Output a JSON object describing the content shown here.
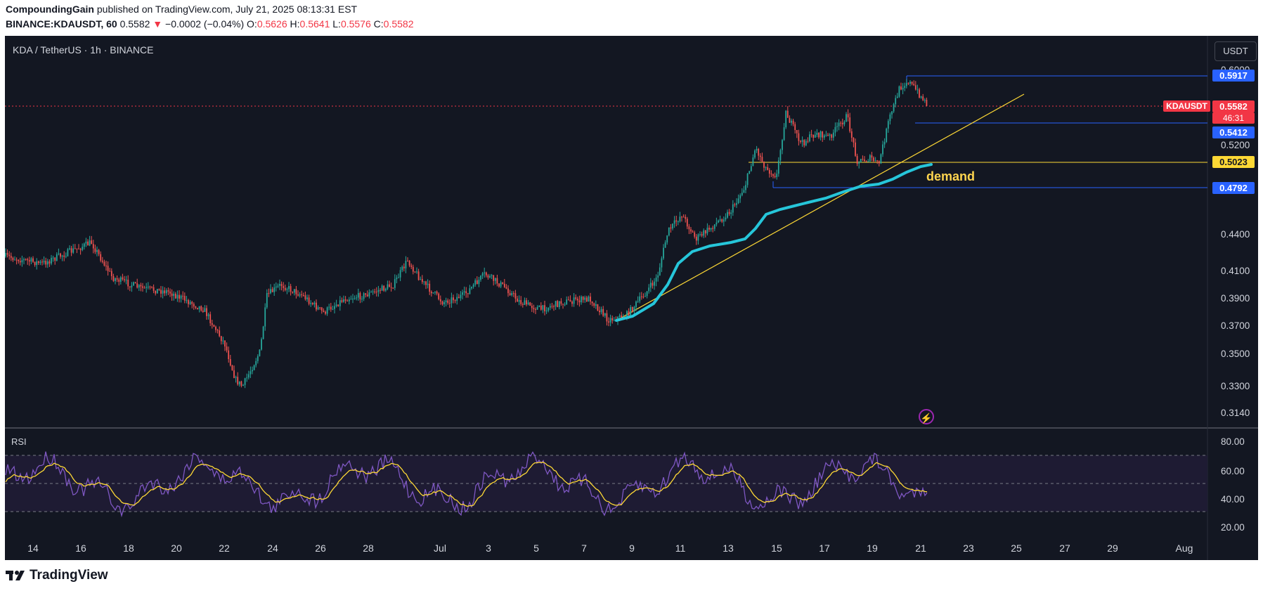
{
  "header": {
    "author": "CompoundingGain",
    "published_text": "published on TradingView.com, July 21, 2025 08:13:31 EST",
    "symbol_line": "BINANCE:KDAUSDT, 60",
    "last": "0.5582",
    "change_arrow": "▼",
    "change": "−0.0002 (−0.04%)",
    "o_label": "O:",
    "o_val": "0.5626",
    "h_label": "H:",
    "h_val": "0.5641",
    "l_label": "L:",
    "l_val": "0.5576",
    "c_label": "C:",
    "c_val": "0.5582"
  },
  "chart": {
    "title": "KDA / TetherUS · 1h · BINANCE",
    "currency_button": "USDT",
    "price_axis_labels": [
      "0.6000",
      "0.5200",
      "0.4400",
      "0.4100",
      "0.3900",
      "0.3700",
      "0.3500",
      "0.3300",
      "0.3140"
    ],
    "tags": {
      "level_5917": "0.5917",
      "symbol_tag": "KDAUSDT",
      "last_price": "0.5582",
      "countdown": "46:31",
      "level_5412": "0.5412",
      "level_5023": "0.5023",
      "level_4792": "0.4792"
    },
    "demand_label": "demand",
    "bolt_icon": "⚡"
  },
  "rsi": {
    "title": "RSI",
    "axis_labels": [
      "80.00",
      "60.00",
      "40.00",
      "20.00"
    ]
  },
  "time_axis": [
    "14",
    "16",
    "18",
    "20",
    "22",
    "24",
    "26",
    "28",
    "Jul",
    "3",
    "5",
    "7",
    "9",
    "11",
    "13",
    "15",
    "17",
    "19",
    "21",
    "23",
    "25",
    "27",
    "29",
    "Aug"
  ],
  "footer": {
    "brand": "TradingView"
  },
  "colors": {
    "background": "#131722",
    "up": "#26a69a",
    "down": "#ef5350",
    "rsi_line": "#7e57c2",
    "rsi_ma": "#fdd835",
    "ema": "#26c6da",
    "trendline": "#fdd835",
    "level_blue": "#2962ff",
    "level_yellow": "#fdd835"
  },
  "chart_data": {
    "type": "candlestick",
    "symbol": "KDA / TetherUS",
    "interval": "1h",
    "x": [
      "14",
      "16",
      "18",
      "20",
      "22",
      "24",
      "26",
      "28",
      "Jul",
      "3",
      "5",
      "7",
      "9",
      "11",
      "13",
      "15",
      "17",
      "19",
      "21"
    ],
    "close_approx": [
      0.425,
      0.418,
      0.395,
      0.39,
      0.332,
      0.398,
      0.385,
      0.395,
      0.41,
      0.405,
      0.383,
      0.378,
      0.395,
      0.465,
      0.47,
      0.52,
      0.528,
      0.502,
      0.558
    ],
    "levels": [
      0.5917,
      0.5412,
      0.5023,
      0.4792
    ],
    "last_price": 0.5582,
    "ylim": [
      0.31,
      0.61
    ],
    "rsi_ylim": [
      10,
      85
    ],
    "rsi_bands": [
      30,
      50,
      70
    ]
  }
}
